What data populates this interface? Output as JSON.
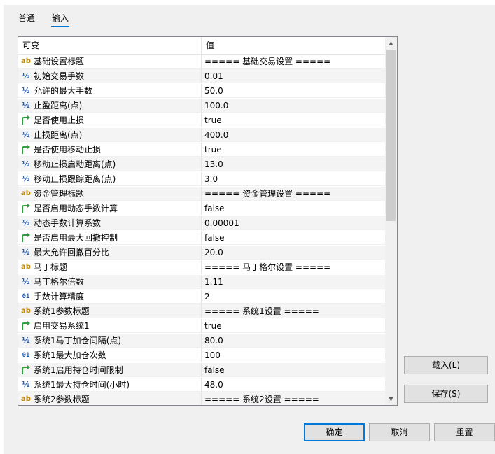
{
  "tabs": [
    {
      "label": "普通"
    },
    {
      "label": "输入"
    }
  ],
  "active_tab": 1,
  "grid": {
    "columns": [
      "可变",
      "值"
    ],
    "rows": [
      {
        "type": "ab",
        "name": "基础设置标题",
        "value": "===== 基础交易设置 ====="
      },
      {
        "type": "half",
        "name": "初始交易手数",
        "value": "0.01"
      },
      {
        "type": "half",
        "name": "允许的最大手数",
        "value": "50.0"
      },
      {
        "type": "half",
        "name": "止盈距离(点)",
        "value": "100.0"
      },
      {
        "type": "bool",
        "name": "是否使用止损",
        "value": "true"
      },
      {
        "type": "half",
        "name": "止损距离(点)",
        "value": "400.0"
      },
      {
        "type": "bool",
        "name": "是否使用移动止损",
        "value": "true"
      },
      {
        "type": "half",
        "name": "移动止损启动距离(点)",
        "value": "13.0"
      },
      {
        "type": "half",
        "name": "移动止损跟踪距离(点)",
        "value": "3.0"
      },
      {
        "type": "ab",
        "name": "资金管理标题",
        "value": "===== 资金管理设置 ====="
      },
      {
        "type": "bool",
        "name": "是否启用动态手数计算",
        "value": "false"
      },
      {
        "type": "half",
        "name": "动态手数计算系数",
        "value": "0.00001"
      },
      {
        "type": "bool",
        "name": "是否启用最大回撤控制",
        "value": "false"
      },
      {
        "type": "half",
        "name": "最大允许回撤百分比",
        "value": "20.0"
      },
      {
        "type": "ab",
        "name": "马丁标题",
        "value": "===== 马丁格尔设置 ====="
      },
      {
        "type": "half",
        "name": "马丁格尔倍数",
        "value": "1.11"
      },
      {
        "type": "int",
        "name": "手数计算精度",
        "value": "2"
      },
      {
        "type": "ab",
        "name": "系统1参数标题",
        "value": "===== 系统1设置 ====="
      },
      {
        "type": "bool",
        "name": "启用交易系统1",
        "value": "true"
      },
      {
        "type": "half",
        "name": "系统1马丁加仓间隔(点)",
        "value": "80.0"
      },
      {
        "type": "int",
        "name": "系统1最大加仓次数",
        "value": "100"
      },
      {
        "type": "bool",
        "name": "系统1启用持仓时间限制",
        "value": "false"
      },
      {
        "type": "half",
        "name": "系统1最大持仓时间(小时)",
        "value": "48.0"
      },
      {
        "type": "ab",
        "name": "系统2参数标题",
        "value": "===== 系统2设置 ====="
      }
    ]
  },
  "icons": {
    "ab": "ab",
    "half": "½",
    "int": "01",
    "bool": "bool-arrow-icon"
  },
  "buttons": {
    "load": "载入(L)",
    "save": "保存(S)",
    "ok": "确定",
    "cancel": "取消",
    "reset": "重置"
  },
  "colors": {
    "accent": "#0078d7",
    "ab_icon": "#b8860b",
    "num_icon": "#1e5fbf",
    "bool_icon": "#2e9e3e"
  }
}
